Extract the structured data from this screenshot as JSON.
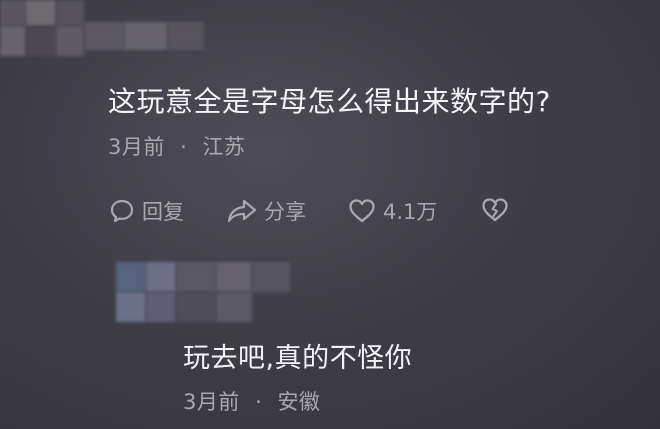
{
  "top_comment": {
    "text": "这玩意全是字母怎么得出来数字的?",
    "time": "3月前",
    "separator": "·",
    "location": "江苏",
    "actions": {
      "reply_label": "回复",
      "share_label": "分享",
      "like_count": "4.1万"
    }
  },
  "reply_comment": {
    "text": "玩去吧,真的不怪你",
    "time": "3月前",
    "separator": "·",
    "location": "安徽"
  },
  "colors": {
    "background": "#3f3e47",
    "text_primary": "#f4f4f6",
    "text_secondary": "#a9a8b0"
  },
  "icons": [
    "reply-icon",
    "share-icon",
    "like-heart-icon",
    "dislike-broken-heart-icon"
  ]
}
